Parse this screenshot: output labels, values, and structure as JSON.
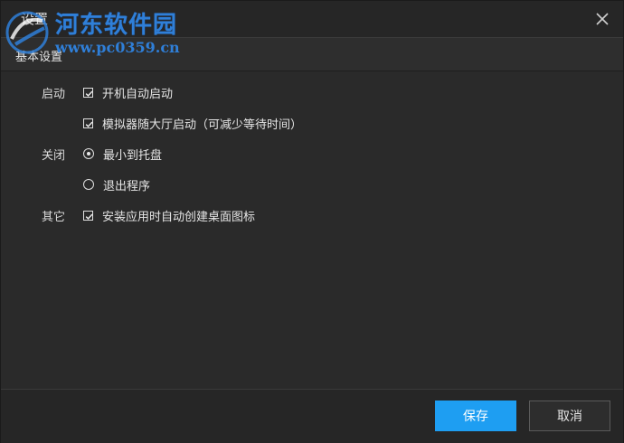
{
  "window": {
    "title": "设置"
  },
  "watermark": {
    "name": "河东软件园",
    "url": "www.pc0359.cn"
  },
  "section": {
    "title": "基本设置"
  },
  "groups": {
    "startup": {
      "label": "启动",
      "options": [
        {
          "label": "开机自动启动",
          "type": "checkbox",
          "checked": true
        },
        {
          "label": "模拟器随大厅启动（可减少等待时间）",
          "type": "checkbox",
          "checked": true
        }
      ]
    },
    "close": {
      "label": "关闭",
      "options": [
        {
          "label": "最小到托盘",
          "type": "radio",
          "checked": true
        },
        {
          "label": "退出程序",
          "type": "radio",
          "checked": false
        }
      ]
    },
    "other": {
      "label": "其它",
      "options": [
        {
          "label": "安装应用时自动创建桌面图标",
          "type": "checkbox",
          "checked": true
        }
      ]
    }
  },
  "footer": {
    "save_label": "保存",
    "cancel_label": "取消"
  },
  "colors": {
    "accent": "#1e9ef2",
    "background": "#2a2a2a",
    "watermark": "#2f7fd8"
  }
}
